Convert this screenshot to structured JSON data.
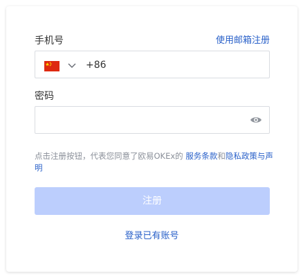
{
  "form": {
    "phone_label": "手机号",
    "email_register_link": "使用邮箱注册",
    "country_flag": "china-flag-icon",
    "country_code": "+86",
    "phone_value": "",
    "password_label": "密码",
    "password_value": "",
    "agreement": {
      "prefix": "点击注册按钮，代表您同意了欧易OKEx的 ",
      "terms_link": "服务条款",
      "conjunction": "和",
      "privacy_link": "隐私政策与声明"
    },
    "register_button": "注册",
    "login_link": "登录已有账号"
  },
  "colors": {
    "accent": "#2a61c9",
    "button_disabled": "#bccefd",
    "border": "#d9dce1"
  }
}
